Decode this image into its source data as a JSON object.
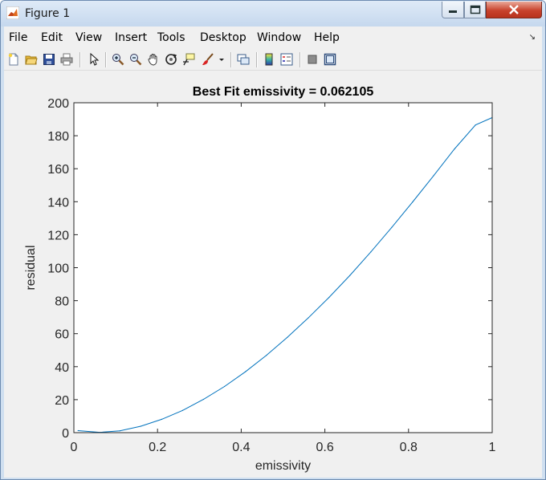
{
  "window": {
    "title": "Figure 1"
  },
  "menu": {
    "items": [
      {
        "label": "File"
      },
      {
        "label": "Edit"
      },
      {
        "label": "View"
      },
      {
        "label": "Insert"
      },
      {
        "label": "Tools"
      },
      {
        "label": "Desktop"
      },
      {
        "label": "Window"
      },
      {
        "label": "Help"
      }
    ]
  },
  "toolbar": {
    "icons": [
      "new-figure-icon",
      "open-file-icon",
      "save-icon",
      "print-icon",
      "edit-plot-arrow-icon",
      "zoom-in-icon",
      "zoom-out-icon",
      "pan-hand-icon",
      "rotate-3d-icon",
      "data-cursor-icon",
      "brush-icon",
      "brush-dropdown-icon",
      "link-plot-icon",
      "insert-colorbar-icon",
      "insert-legend-icon",
      "hide-plot-tools-icon",
      "show-plot-tools-icon"
    ]
  },
  "colors": {
    "line": "#0072bd",
    "axes_background": "#ffffff",
    "figure_background": "#f0f0f0"
  },
  "chart_data": {
    "type": "line",
    "title": "Best Fit emissivity = 0.062105",
    "xlabel": "emissivity",
    "ylabel": "residual",
    "xlim": [
      0,
      1
    ],
    "ylim": [
      0,
      200
    ],
    "xticks": [
      "0",
      "0.2",
      "0.4",
      "0.6",
      "0.8",
      "1"
    ],
    "yticks": [
      "0",
      "20",
      "40",
      "60",
      "80",
      "100",
      "120",
      "140",
      "160",
      "180",
      "200"
    ],
    "grid": false,
    "series": [
      {
        "x": [
          0.01,
          0.062,
          0.11,
          0.16,
          0.21,
          0.26,
          0.31,
          0.36,
          0.41,
          0.46,
          0.51,
          0.56,
          0.61,
          0.66,
          0.71,
          0.76,
          0.81,
          0.86,
          0.91,
          0.96,
          1.0
        ],
        "y": [
          1.2,
          0.2,
          1.1,
          3.9,
          8.1,
          13.5,
          20.2,
          28.0,
          36.9,
          46.8,
          57.7,
          69.5,
          82.0,
          95.4,
          109.6,
          124.5,
          139.9,
          155.8,
          172.0,
          186.5,
          191.0
        ]
      }
    ]
  }
}
